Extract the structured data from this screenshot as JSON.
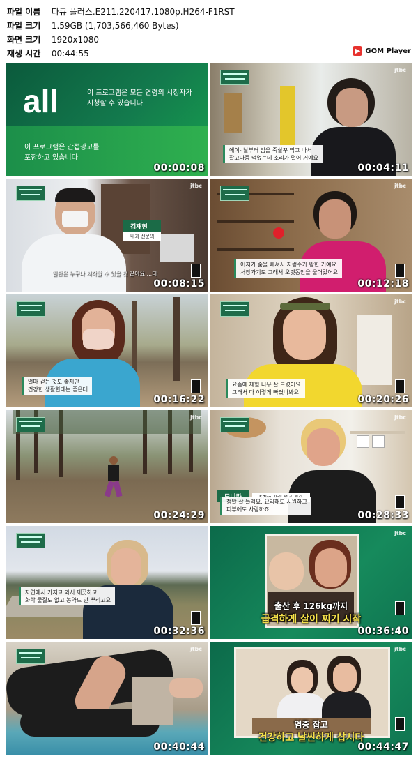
{
  "header": {
    "rows": [
      {
        "key": "파일 이름",
        "value": "다큐 플러스.E211.220417.1080p.H264-F1RST"
      },
      {
        "key": "파일 크기",
        "value": "1.59GB (1,703,566,460 Bytes)"
      },
      {
        "key": "화면 크기",
        "value": "1920x1080"
      },
      {
        "key": "재생 시간",
        "value": "00:44:55"
      }
    ],
    "logo": "GOM Player"
  },
  "colors": {
    "accent_green": "#1b6b47",
    "logo_red": "#e7322e",
    "caption_yellow": "#f4e04a"
  },
  "thumbs": [
    {
      "time": "00:00:08",
      "rating_big": "all",
      "rating_line1": "이 프로그램은 모든 연령의 시청자가",
      "rating_line2": "시청할 수 있습니다",
      "ad_line1": "이 프로그램은 간접광고를",
      "ad_line2": "포함하고 있습니다"
    },
    {
      "time": "00:04:11",
      "caption": "에이- 날부터 밥을 죽살꾸 먹고 나서\n잘고나중 먹었는데 소리가 덜어 거예요"
    },
    {
      "time": "00:08:15",
      "name": "김재현",
      "role": "내과 전문의",
      "caption": "일단은 누구나 시작할 수 있을 것 같아요 ...다"
    },
    {
      "time": "00:12:18",
      "caption": "어지가 숨을 빼셔서 지렁수가 왕한 거예요\n서장가기도 그래서 오랫동안을 울어갔어요"
    },
    {
      "time": "00:16:22",
      "caption": "얼마 걷는 것도 좋지만\n건강한 생활한테는 좋은데"
    },
    {
      "time": "00:20:26",
      "caption": "요즘에 체험 너무 잘 드렸어요\n그래서 다 이렇게 빠졌나봐요"
    },
    {
      "time": "00:24:29"
    },
    {
      "time": "00:28:33",
      "name": "모니카",
      "role": "57kg 감량 성공 결혼",
      "caption": "정말 잘 들려요, 요리해도 시원하고\n피부에도 사랑하죠"
    },
    {
      "time": "00:32:36",
      "caption": "자연에서 가지고 와서 깨끗하고\n화학 물질도 없고 농약도 안 뿌리고요"
    },
    {
      "time": "00:36:40",
      "cap_line1": "출산 후 126kg까지",
      "cap_line2": "급격하게 살이 찌기 시작"
    },
    {
      "time": "00:40:44"
    },
    {
      "time": "00:44:47",
      "cap_line1": "염증 잡고",
      "cap_line2": "건강하고 날씬하게 삽시다"
    }
  ]
}
